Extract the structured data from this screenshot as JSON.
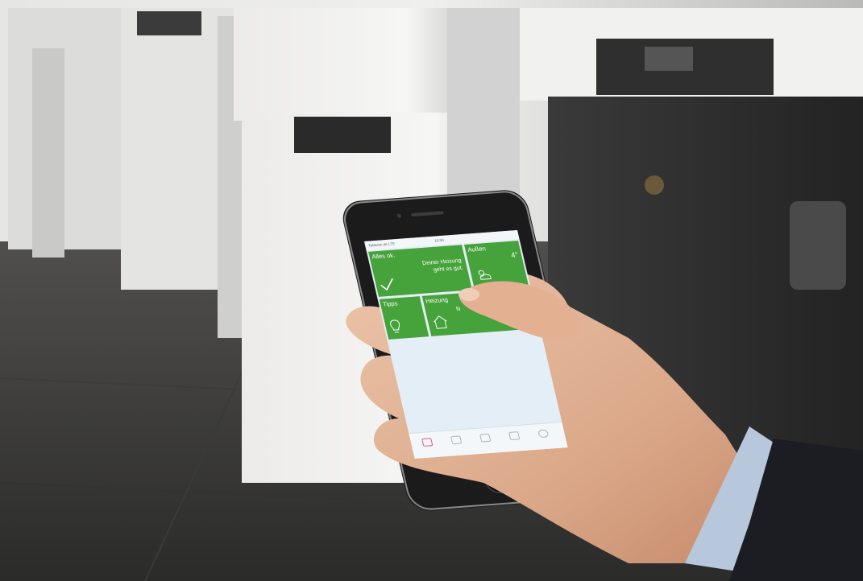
{
  "status_bar": {
    "carrier": "Telekom.de LTE",
    "time": "10:00"
  },
  "tiles": {
    "alles_ok": {
      "label": "Alles ok.",
      "message_line1": "Deiner Heizung",
      "message_line2": "geht es gut."
    },
    "aussen": {
      "label": "Außen",
      "temperature": "4°"
    },
    "tipps": {
      "label": "Tipps"
    },
    "heizung": {
      "label": "Heizung",
      "value": "N"
    }
  },
  "tab_bar": {
    "active_index": 0,
    "tab_count": 5
  },
  "colors": {
    "tile_green": "#46a23a",
    "screen_background": "#e4eef6",
    "active_tab": "#e05a8a"
  },
  "icons": [
    "checkmark-icon",
    "sun-cloud-icon",
    "lightbulb-icon",
    "house-icon",
    "home-tab-icon",
    "tips-tab-icon",
    "boiler-tab-icon",
    "camera-tab-icon",
    "settings-tab-icon"
  ]
}
